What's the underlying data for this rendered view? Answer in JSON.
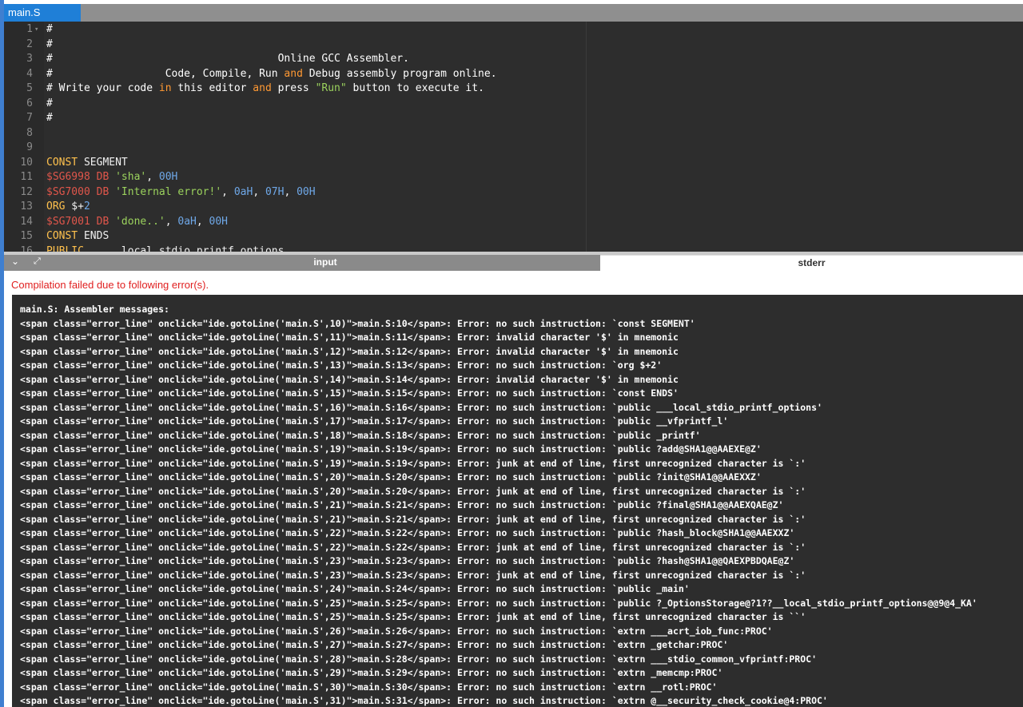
{
  "tab": {
    "filename": "main.S"
  },
  "editor": {
    "lines": [
      {
        "num": "1",
        "fold": true,
        "segments": [
          [
            "c-comment",
            "#"
          ]
        ]
      },
      {
        "num": "2",
        "segments": [
          [
            "c-comment",
            "#"
          ]
        ]
      },
      {
        "num": "3",
        "segments": [
          [
            "c-comment",
            "#                                    Online GCC Assembler."
          ]
        ]
      },
      {
        "num": "4",
        "segments": [
          [
            "c-comment",
            "#                  Code, Compile, Run "
          ],
          [
            "c-kw",
            "and"
          ],
          [
            "c-comment",
            " Debug assembly program online."
          ]
        ]
      },
      {
        "num": "5",
        "segments": [
          [
            "c-comment",
            "# Write your code "
          ],
          [
            "c-kw",
            "in"
          ],
          [
            "c-comment",
            " this editor "
          ],
          [
            "c-kw",
            "and"
          ],
          [
            "c-comment",
            " press "
          ],
          [
            "c-str",
            "\"Run\""
          ],
          [
            "c-comment",
            " button to execute it."
          ]
        ]
      },
      {
        "num": "6",
        "segments": [
          [
            "c-comment",
            "#"
          ]
        ]
      },
      {
        "num": "7",
        "segments": [
          [
            "c-comment",
            "#"
          ]
        ]
      },
      {
        "num": "8",
        "segments": []
      },
      {
        "num": "9",
        "segments": []
      },
      {
        "num": "10",
        "segments": [
          [
            "c-dir",
            "CONST"
          ],
          [
            "c-white",
            " SEGMENT"
          ]
        ]
      },
      {
        "num": "11",
        "segments": [
          [
            "c-label",
            "$SG6998"
          ],
          [
            "c-white",
            " "
          ],
          [
            "c-red",
            "DB"
          ],
          [
            "c-white",
            " "
          ],
          [
            "c-str",
            "'sha'"
          ],
          [
            "c-white",
            ", "
          ],
          [
            "c-num",
            "00H"
          ]
        ]
      },
      {
        "num": "12",
        "segments": [
          [
            "c-label",
            "$SG7000"
          ],
          [
            "c-white",
            " "
          ],
          [
            "c-red",
            "DB"
          ],
          [
            "c-white",
            " "
          ],
          [
            "c-str",
            "'Internal error!'"
          ],
          [
            "c-white",
            ", "
          ],
          [
            "c-num",
            "0aH"
          ],
          [
            "c-white",
            ", "
          ],
          [
            "c-num",
            "07H"
          ],
          [
            "c-white",
            ", "
          ],
          [
            "c-num",
            "00H"
          ]
        ]
      },
      {
        "num": "13",
        "segments": [
          [
            "c-dir",
            "ORG"
          ],
          [
            "c-white",
            " $+"
          ],
          [
            "c-num",
            "2"
          ]
        ]
      },
      {
        "num": "14",
        "segments": [
          [
            "c-label",
            "$SG7001"
          ],
          [
            "c-white",
            " "
          ],
          [
            "c-red",
            "DB"
          ],
          [
            "c-white",
            " "
          ],
          [
            "c-str",
            "'done..'"
          ],
          [
            "c-white",
            ", "
          ],
          [
            "c-num",
            "0aH"
          ],
          [
            "c-white",
            ", "
          ],
          [
            "c-num",
            "00H"
          ]
        ]
      },
      {
        "num": "15",
        "segments": [
          [
            "c-dir",
            "CONST"
          ],
          [
            "c-white",
            " ENDS"
          ]
        ]
      },
      {
        "num": "16",
        "segments": [
          [
            "c-dir",
            "PUBLIC"
          ],
          [
            "c-white",
            "   ___local_stdio_printf_options"
          ]
        ]
      }
    ]
  },
  "io_tabs": {
    "input_label": "input",
    "stderr_label": "stderr"
  },
  "output": {
    "error_title": "Compilation failed due to following error(s).",
    "lines": [
      "main.S: Assembler messages:",
      "<span class=\"error_line\" onclick=\"ide.gotoLine('main.S',10)\">main.S:10</span>: Error: no such instruction: `const SEGMENT'",
      "<span class=\"error_line\" onclick=\"ide.gotoLine('main.S',11)\">main.S:11</span>: Error: invalid character '$' in mnemonic",
      "<span class=\"error_line\" onclick=\"ide.gotoLine('main.S',12)\">main.S:12</span>: Error: invalid character '$' in mnemonic",
      "<span class=\"error_line\" onclick=\"ide.gotoLine('main.S',13)\">main.S:13</span>: Error: no such instruction: `org $+2'",
      "<span class=\"error_line\" onclick=\"ide.gotoLine('main.S',14)\">main.S:14</span>: Error: invalid character '$' in mnemonic",
      "<span class=\"error_line\" onclick=\"ide.gotoLine('main.S',15)\">main.S:15</span>: Error: no such instruction: `const ENDS'",
      "<span class=\"error_line\" onclick=\"ide.gotoLine('main.S',16)\">main.S:16</span>: Error: no such instruction: `public ___local_stdio_printf_options'",
      "<span class=\"error_line\" onclick=\"ide.gotoLine('main.S',17)\">main.S:17</span>: Error: no such instruction: `public __vfprintf_l'",
      "<span class=\"error_line\" onclick=\"ide.gotoLine('main.S',18)\">main.S:18</span>: Error: no such instruction: `public _printf'",
      "<span class=\"error_line\" onclick=\"ide.gotoLine('main.S',19)\">main.S:19</span>: Error: no such instruction: `public ?add@SHA1@@AAEXE@Z'",
      "<span class=\"error_line\" onclick=\"ide.gotoLine('main.S',19)\">main.S:19</span>: Error: junk at end of line, first unrecognized character is `:'",
      "<span class=\"error_line\" onclick=\"ide.gotoLine('main.S',20)\">main.S:20</span>: Error: no such instruction: `public ?init@SHA1@@AAEXXZ'",
      "<span class=\"error_line\" onclick=\"ide.gotoLine('main.S',20)\">main.S:20</span>: Error: junk at end of line, first unrecognized character is `:'",
      "<span class=\"error_line\" onclick=\"ide.gotoLine('main.S',21)\">main.S:21</span>: Error: no such instruction: `public ?final@SHA1@@AAEXQAE@Z'",
      "<span class=\"error_line\" onclick=\"ide.gotoLine('main.S',21)\">main.S:21</span>: Error: junk at end of line, first unrecognized character is `:'",
      "<span class=\"error_line\" onclick=\"ide.gotoLine('main.S',22)\">main.S:22</span>: Error: no such instruction: `public ?hash_block@SHA1@@AAEXXZ'",
      "<span class=\"error_line\" onclick=\"ide.gotoLine('main.S',22)\">main.S:22</span>: Error: junk at end of line, first unrecognized character is `:'",
      "<span class=\"error_line\" onclick=\"ide.gotoLine('main.S',23)\">main.S:23</span>: Error: no such instruction: `public ?hash@SHA1@@QAEXPBDQAE@Z'",
      "<span class=\"error_line\" onclick=\"ide.gotoLine('main.S',23)\">main.S:23</span>: Error: junk at end of line, first unrecognized character is `:'",
      "<span class=\"error_line\" onclick=\"ide.gotoLine('main.S',24)\">main.S:24</span>: Error: no such instruction: `public _main'",
      "<span class=\"error_line\" onclick=\"ide.gotoLine('main.S',25)\">main.S:25</span>: Error: no such instruction: `public ?_OptionsStorage@?1??__local_stdio_printf_options@@9@4_KA'",
      "<span class=\"error_line\" onclick=\"ide.gotoLine('main.S',25)\">main.S:25</span>: Error: junk at end of line, first unrecognized character is ``'",
      "<span class=\"error_line\" onclick=\"ide.gotoLine('main.S',26)\">main.S:26</span>: Error: no such instruction: `extrn ___acrt_iob_func:PROC'",
      "<span class=\"error_line\" onclick=\"ide.gotoLine('main.S',27)\">main.S:27</span>: Error: no such instruction: `extrn _getchar:PROC'",
      "<span class=\"error_line\" onclick=\"ide.gotoLine('main.S',28)\">main.S:28</span>: Error: no such instruction: `extrn ___stdio_common_vfprintf:PROC'",
      "<span class=\"error_line\" onclick=\"ide.gotoLine('main.S',29)\">main.S:29</span>: Error: no such instruction: `extrn _memcmp:PROC'",
      "<span class=\"error_line\" onclick=\"ide.gotoLine('main.S',30)\">main.S:30</span>: Error: no such instruction: `extrn __rotl:PROC'",
      "<span class=\"error_line\" onclick=\"ide.gotoLine('main.S',31)\">main.S:31</span>: Error: no such instruction: `extrn @__security_check_cookie@4:PROC'"
    ]
  }
}
